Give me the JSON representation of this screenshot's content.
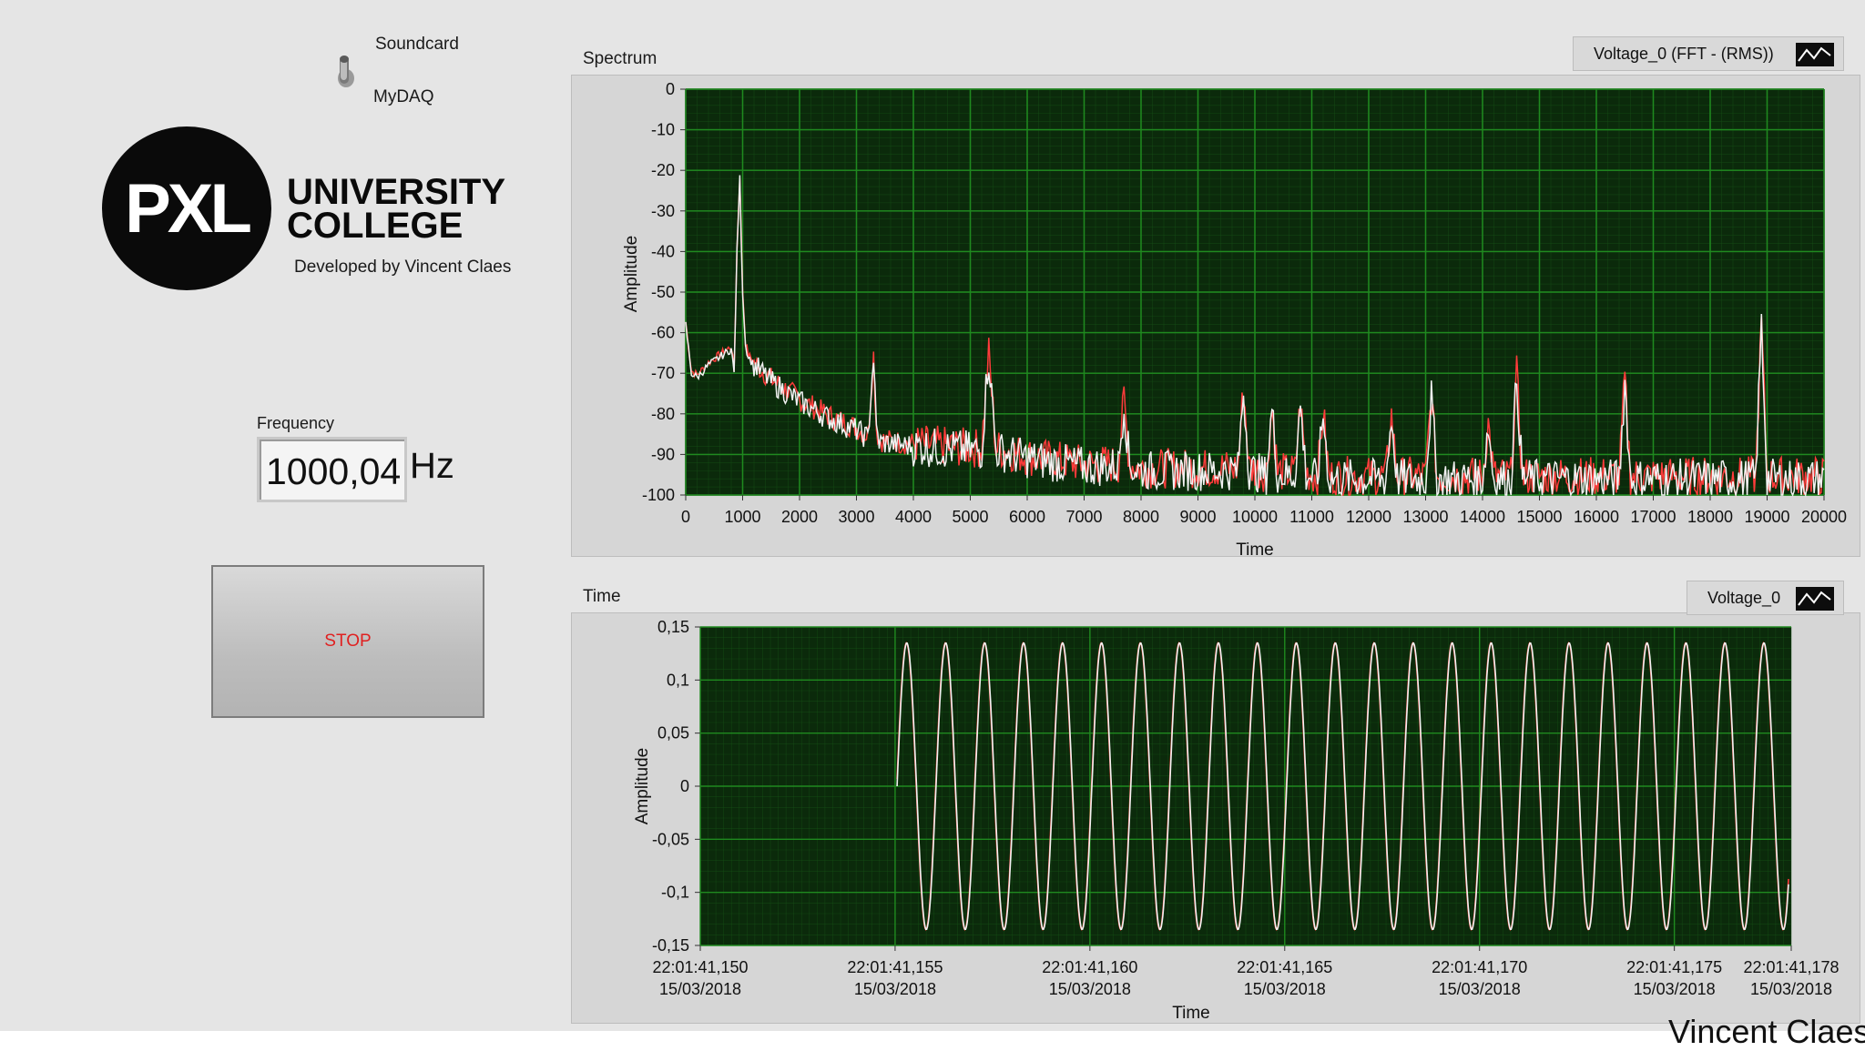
{
  "switch": {
    "top_label": "Soundcard",
    "bottom_label": "MyDAQ"
  },
  "logo": {
    "mark": "PXL",
    "line1": "UNIVERSITY",
    "line2": "COLLEGE",
    "developer": "Developed by Vincent Claes"
  },
  "frequency": {
    "label": "Frequency",
    "value": "1000,04",
    "unit": "Hz"
  },
  "stop_button": {
    "label": "STOP",
    "label_color": "#e02020"
  },
  "spectrum": {
    "title": "Spectrum",
    "legend": "Voltage_0 (FFT - (RMS))",
    "xlabel": "Time",
    "ylabel": "Amplitude",
    "x_ticks": [
      "0",
      "1000",
      "2000",
      "3000",
      "4000",
      "5000",
      "6000",
      "7000",
      "8000",
      "9000",
      "10000",
      "11000",
      "12000",
      "13000",
      "14000",
      "15000",
      "16000",
      "17000",
      "18000",
      "19000",
      "20000"
    ],
    "y_ticks": [
      "0",
      "-10",
      "-20",
      "-30",
      "-40",
      "-50",
      "-60",
      "-70",
      "-80",
      "-90",
      "-100"
    ]
  },
  "time": {
    "title": "Time",
    "legend": "Voltage_0",
    "xlabel": "Time",
    "ylabel": "Amplitude",
    "x_ticks": [
      {
        "time": "22:01:41,150",
        "date": "15/03/2018"
      },
      {
        "time": "22:01:41,155",
        "date": "15/03/2018"
      },
      {
        "time": "22:01:41,160",
        "date": "15/03/2018"
      },
      {
        "time": "22:01:41,165",
        "date": "15/03/2018"
      },
      {
        "time": "22:01:41,170",
        "date": "15/03/2018"
      },
      {
        "time": "22:01:41,175",
        "date": "15/03/2018"
      },
      {
        "time": "22:01:41,178",
        "date": "15/03/2018"
      }
    ],
    "y_ticks": [
      "0,15",
      "0,1",
      "0,05",
      "0",
      "-0,05",
      "-0,1",
      "-0,15"
    ]
  },
  "chart_data": [
    {
      "type": "line",
      "title": "Spectrum",
      "xlabel": "Time",
      "ylabel": "Amplitude",
      "xlim": [
        0,
        20000
      ],
      "ylim": [
        -100,
        0
      ],
      "grid": true,
      "legend_position": "top-right",
      "colors": {
        "plot_bg": "#0b2a0b",
        "grid": "#1f8a1f",
        "trace_white": "#f2f2f2",
        "trace_red": "#ff3b3b"
      },
      "series": [
        {
          "name": "Voltage_0 (FFT - (RMS))",
          "x": [
            0,
            100,
            200,
            400,
            600,
            800,
            850,
            900,
            950,
            1000,
            1050,
            1100,
            1200,
            1500,
            2000,
            2500,
            3000,
            3200,
            3300,
            3350,
            3400,
            4000,
            5000,
            5200,
            5320,
            5450,
            6000,
            7000,
            7600,
            7700,
            7800,
            8000,
            9000,
            9700,
            9800,
            9900,
            10200,
            10300,
            10400,
            10700,
            10800,
            10900,
            11100,
            11200,
            11300,
            12000,
            12300,
            12400,
            12500,
            13000,
            13100,
            13200,
            13300,
            14000,
            14100,
            14200,
            14500,
            14600,
            14700,
            15000,
            16000,
            16400,
            16500,
            16600,
            17000,
            18000,
            18800,
            18900,
            19000,
            19200,
            20000
          ],
          "y": [
            -58,
            -70,
            -71,
            -68,
            -66,
            -64,
            -70,
            -40,
            -22,
            -50,
            -63,
            -66,
            -68,
            -72,
            -77,
            -81,
            -84,
            -86,
            -66,
            -84,
            -87,
            -88,
            -89,
            -89,
            -65,
            -89,
            -91,
            -93,
            -93,
            -77,
            -93,
            -94,
            -94,
            -94,
            -74,
            -94,
            -95,
            -79,
            -95,
            -95,
            -78,
            -95,
            -96,
            -80,
            -96,
            -96,
            -96,
            -81,
            -96,
            -96,
            -76,
            -96,
            -96,
            -96,
            -83,
            -96,
            -96,
            -71,
            -96,
            -96,
            -96,
            -96,
            -72,
            -96,
            -96,
            -96,
            -96,
            -58,
            -96,
            -96,
            -96
          ]
        }
      ]
    },
    {
      "type": "line",
      "title": "Time",
      "xlabel": "Time",
      "ylabel": "Amplitude",
      "x_start": "22:01:41,150",
      "x_end": "22:01:41,178",
      "signal_start": "22:01:41,155",
      "ylim": [
        -0.15,
        0.15
      ],
      "grid": true,
      "legend_position": "top-right",
      "colors": {
        "plot_bg": "#0b2a0b",
        "grid": "#1f8a1f",
        "trace_white": "#f2f2f2",
        "trace_red": "#ff3b3b"
      },
      "series": [
        {
          "name": "Voltage_0",
          "waveform": "sine",
          "frequency_hz": 1000,
          "amplitude": 0.135
        }
      ]
    }
  ]
}
